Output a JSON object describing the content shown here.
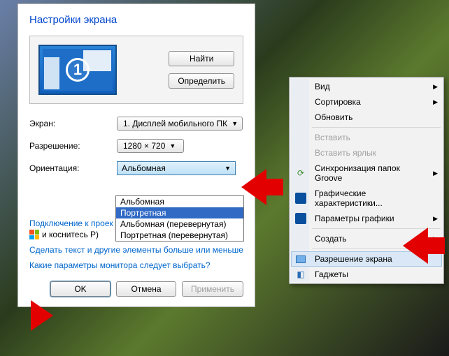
{
  "dialog": {
    "title": "Настройки экрана",
    "find_btn": "Найти",
    "detect_btn": "Определить",
    "monitor_number": "1",
    "rows": {
      "display_label": "Экран:",
      "display_value": "1. Дисплей мобильного ПК",
      "resolution_label": "Разрешение:",
      "resolution_value": "1280 × 720",
      "orientation_label": "Ориентация:",
      "orientation_value": "Альбомная"
    },
    "orientation_options": [
      "Альбомная",
      "Портретная",
      "Альбомная (перевернутая)",
      "Портретная (перевернутая)"
    ],
    "orientation_selected_index": 1,
    "link_connect": "Подключение к проек",
    "sub_hint": "и коснитесь P)",
    "link_textsize": "Сделать текст и другие элементы больше или меньше",
    "link_which": "Какие параметры монитора следует выбрать?",
    "ok": "OK",
    "cancel": "Отмена",
    "apply": "Применить"
  },
  "ctx": {
    "items": [
      {
        "label": "Вид",
        "submenu": true
      },
      {
        "label": "Сортировка",
        "submenu": true
      },
      {
        "label": "Обновить"
      },
      {
        "sep": true
      },
      {
        "label": "Вставить",
        "disabled": true
      },
      {
        "label": "Вставить ярлык",
        "disabled": true
      },
      {
        "label": "Синхронизация папок Groove",
        "icon": "groove",
        "submenu": true
      },
      {
        "label": "Графические характеристики...",
        "icon": "intel"
      },
      {
        "label": "Параметры графики",
        "icon": "intel",
        "submenu": true
      },
      {
        "sep": true
      },
      {
        "label": "Создать",
        "submenu": true
      },
      {
        "sep": true
      },
      {
        "label": "Разрешение экрана",
        "icon": "monitor",
        "highlight": true
      },
      {
        "label": "Гаджеты",
        "icon": "gadget"
      }
    ]
  }
}
